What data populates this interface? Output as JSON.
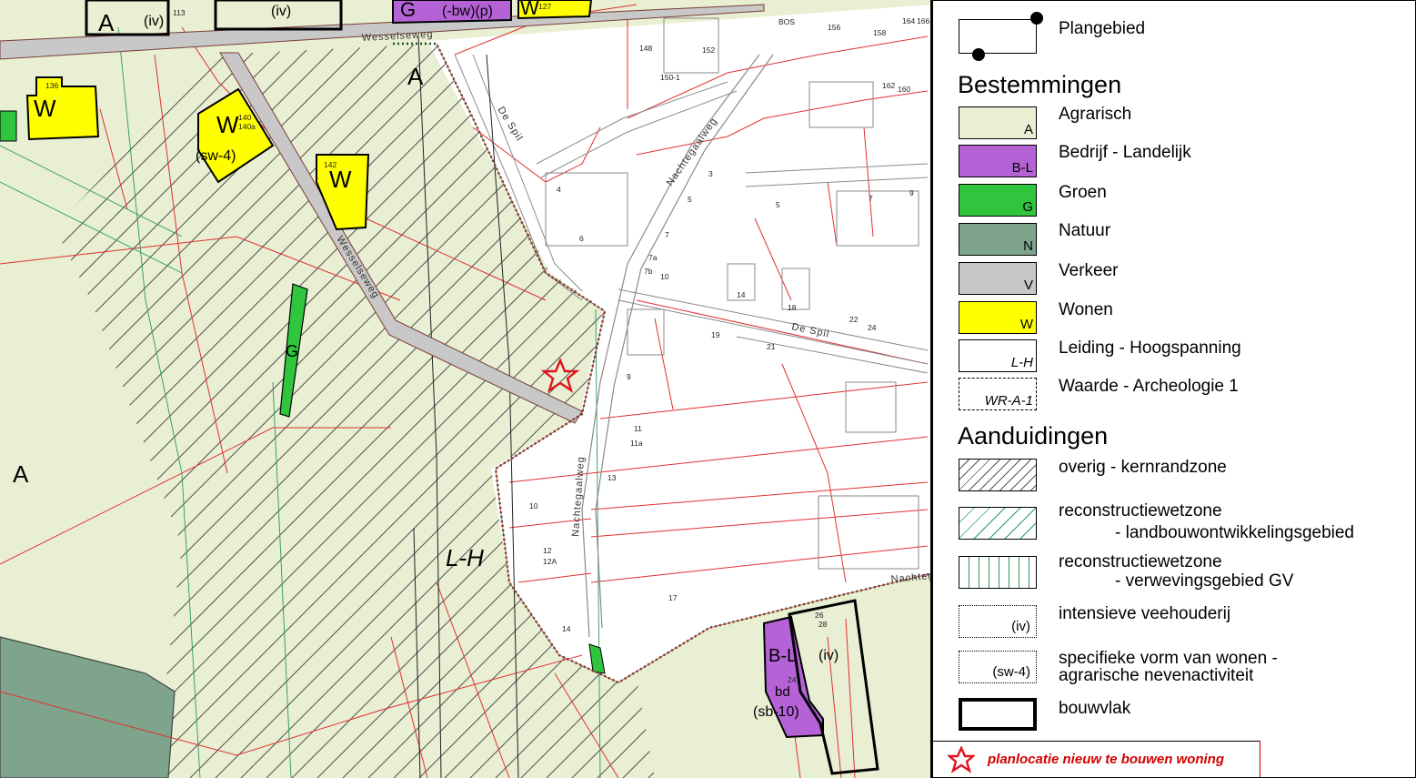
{
  "map": {
    "zone_labels": {
      "agrarisch_a_top": "A",
      "agrarisch_a_left": "A",
      "agrarisch_a_topleft": "A",
      "leiding": "L-H",
      "w1": "W",
      "w2": "W",
      "w3": "W",
      "w4": "W",
      "sw4": "(sw-4)",
      "iv_top": "(iv)",
      "iv_bottom": "(iv)",
      "iv_topleft": "(iv)",
      "g_top": "G",
      "bw_p": "(-bw)(p)",
      "g_strip": "G",
      "bl": "B-L",
      "sb10": "(sb-10)",
      "bd": "bd"
    },
    "streets": {
      "wesselseweg_top": "Wesselseweg",
      "wesselseweg_diag": "Wesselseweg",
      "nachtegaalweg_upper": "Nachtegaalweg",
      "nachtegaalweg_lower": "Nachtegaalweg",
      "de_spil_1": "De Spil",
      "de_spil_2": "De Spil",
      "nachtegaalweg_right": "Nachtegaalweg"
    },
    "house_numbers": {
      "n136": "136",
      "n140": "140",
      "n140a": "140a",
      "n142": "142",
      "n113": "113",
      "n127": "127",
      "n148": "148",
      "n150": "150",
      "n150a": "150-1",
      "n152": "152",
      "n156": "156",
      "n158": "158",
      "n164": "164",
      "n166": "166",
      "n162": "162",
      "n160": "160",
      "bos": "BOS",
      "s4": "4",
      "s6": "6",
      "s3": "3",
      "s5a": "5",
      "s5b": "5",
      "s7a": "7",
      "s9a": "9",
      "s7": "7",
      "s7a2": "7a",
      "s7b": "7b",
      "s10": "10",
      "s14": "14",
      "s18": "18",
      "s22": "22",
      "s24": "24",
      "s19": "19",
      "s21": "21",
      "s9": "9",
      "s11": "11",
      "s11a": "11a",
      "s13": "13",
      "n10": "10",
      "n12": "12",
      "n12a": "12A",
      "n14": "14",
      "s17": "17",
      "n26": "26",
      "n28": "28",
      "n24": "24"
    }
  },
  "legend": {
    "plangebied": "Plangebied",
    "bestemmingen": "Bestemmingen",
    "items": [
      {
        "label": "Agrarisch",
        "code": "A",
        "color": "#e8efd2"
      },
      {
        "label": "Bedrijf - Landelijk",
        "code": "B-L",
        "color": "#b562d6"
      },
      {
        "label": "Groen",
        "code": "G",
        "color": "#2fc63d"
      },
      {
        "label": "Natuur",
        "code": "N",
        "color": "#7ea58c"
      },
      {
        "label": "Verkeer",
        "code": "V",
        "color": "#c8c8c8"
      },
      {
        "label": "Wonen",
        "code": "W",
        "color": "#ffff00"
      },
      {
        "label": "Leiding - Hoogspanning",
        "code": "L-H",
        "color": "#ffffff"
      },
      {
        "label": "Waarde - Archeologie 1",
        "code": "WR-A-1",
        "color": "#ffffff"
      }
    ],
    "aanduidingen": "Aanduidingen",
    "ann": {
      "kernrand": "overig - kernrandzone",
      "landbouw_1": "reconstructiewetzone",
      "landbouw_2": "- landbouwontwikkelingsgebied",
      "verweving_1": "reconstructiewetzone",
      "verweving_2": "- verwevingsgebied GV",
      "iv_label": "intensieve veehouderij",
      "iv_code": "(iv)",
      "sw_label_1": "specifieke vorm van wonen -",
      "sw_label_2": "agrarische nevenactiviteit",
      "sw_code": "(sw-4)",
      "bouwvlak": "bouwvlak"
    },
    "footer": "planlocatie nieuw te bouwen woning"
  }
}
